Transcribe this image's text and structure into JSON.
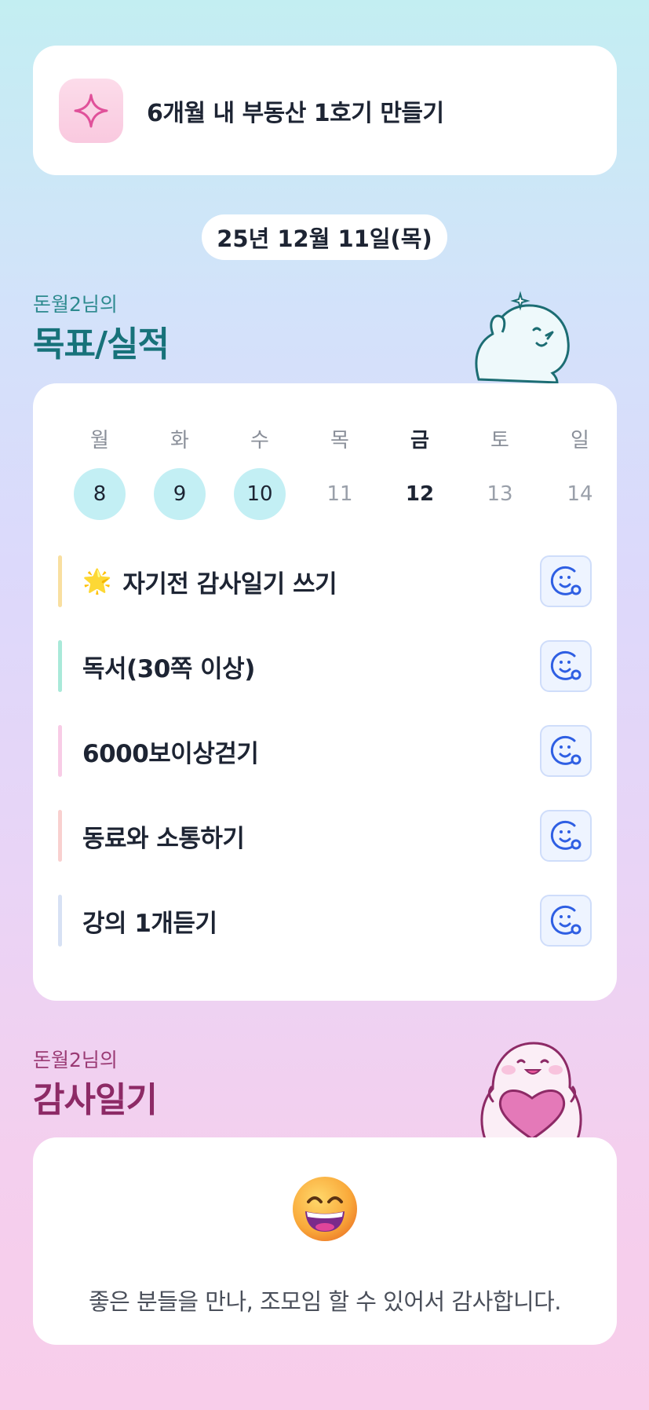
{
  "goal_banner": {
    "text": "6개월 내 부동산 1호기 만들기",
    "icon": "sparkle-icon"
  },
  "date": "25년 12월 11일(목)",
  "goals_section": {
    "subtitle": "돈월2님의",
    "title": "목표/실적"
  },
  "week": {
    "days": [
      "월",
      "화",
      "수",
      "목",
      "금",
      "토",
      "일"
    ],
    "dates": [
      "8",
      "9",
      "10",
      "11",
      "12",
      "13",
      "14"
    ],
    "completed_dates": [
      "8",
      "9",
      "10"
    ],
    "highlight_date": "12"
  },
  "tasks": [
    {
      "label": "자기전 감사일기 쓰기",
      "emoji": "🌟",
      "bar_color": "#f9dfa0"
    },
    {
      "label": "독서(30쪽 이상)",
      "bar_color": "#a9e9d9"
    },
    {
      "label": "6000보이상걷기",
      "bar_color": "#f8cce6"
    },
    {
      "label": "동료와 소통하기",
      "bar_color": "#f9d0cf"
    },
    {
      "label": "강의 1개듣기",
      "bar_color": "#d7e1f4"
    }
  ],
  "gratitude_section": {
    "subtitle": "돈월2님의",
    "title": "감사일기"
  },
  "gratitude_entry": {
    "emoji": "grinning-face-icon",
    "text": "좋은 분들을 만나, 조모임 할 수 있어서 감사합니다."
  },
  "colors": {
    "accent_blue": "#2f5fe3",
    "done_circle": "#c3eff4",
    "teal_title": "#17727a",
    "pink_title": "#8d2a66"
  }
}
